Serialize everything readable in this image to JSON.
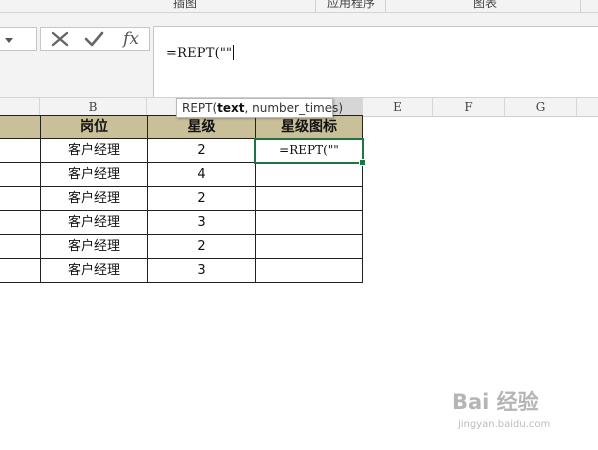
{
  "ribbon_groups": [
    "插图",
    "应用程序",
    "图表"
  ],
  "formula_bar": {
    "cancel_icon": "x-icon",
    "enter_icon": "check-icon",
    "fx_label": "fx",
    "formula": "=REPT(\"\""
  },
  "columns": [
    "B",
    "E",
    "F",
    "G"
  ],
  "tooltip": {
    "func": "REPT(",
    "arg1": "text",
    "rest": ", number_times)"
  },
  "table": {
    "headers": [
      "岗位",
      "星级",
      "星级图标"
    ],
    "rows": [
      {
        "position": "客户经理",
        "level": "2",
        "icon": "=REPT(\"\""
      },
      {
        "position": "客户经理",
        "level": "4",
        "icon": ""
      },
      {
        "position": "客户经理",
        "level": "2",
        "icon": ""
      },
      {
        "position": "客户经理",
        "level": "3",
        "icon": ""
      },
      {
        "position": "客户经理",
        "level": "2",
        "icon": ""
      },
      {
        "position": "客户经理",
        "level": "3",
        "icon": ""
      }
    ]
  },
  "colors": {
    "header_fill": "#c9bf98",
    "selection": "#217346"
  },
  "watermark": {
    "brand": "Bai 经验",
    "url": "jingyan.baidu.com"
  }
}
